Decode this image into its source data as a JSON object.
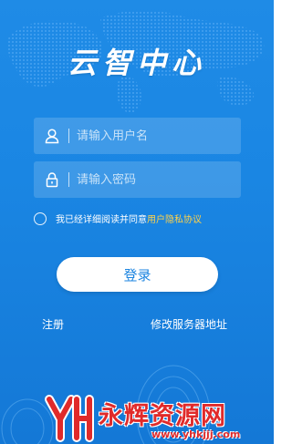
{
  "app": {
    "title": "云智中心"
  },
  "login_form": {
    "username_placeholder": "请输入用户名",
    "password_placeholder": "请输入密码",
    "agreement_text": "我已经详细阅读并同意",
    "agreement_link": "用户隐私协议",
    "login_button": "登录"
  },
  "footer_links": {
    "register": "注册",
    "change_server": "修改服务器地址"
  },
  "watermark": {
    "name": "永辉资源网",
    "url": "www.yhkjjj.com"
  },
  "icons": {
    "username": "user-icon",
    "password": "lock-icon",
    "agreement": "radio-unchecked-icon"
  },
  "colors": {
    "background": "#1a86e3",
    "button_text": "#1b84e0",
    "link_accent": "#ffd24a",
    "watermark": "#e02a2a"
  }
}
